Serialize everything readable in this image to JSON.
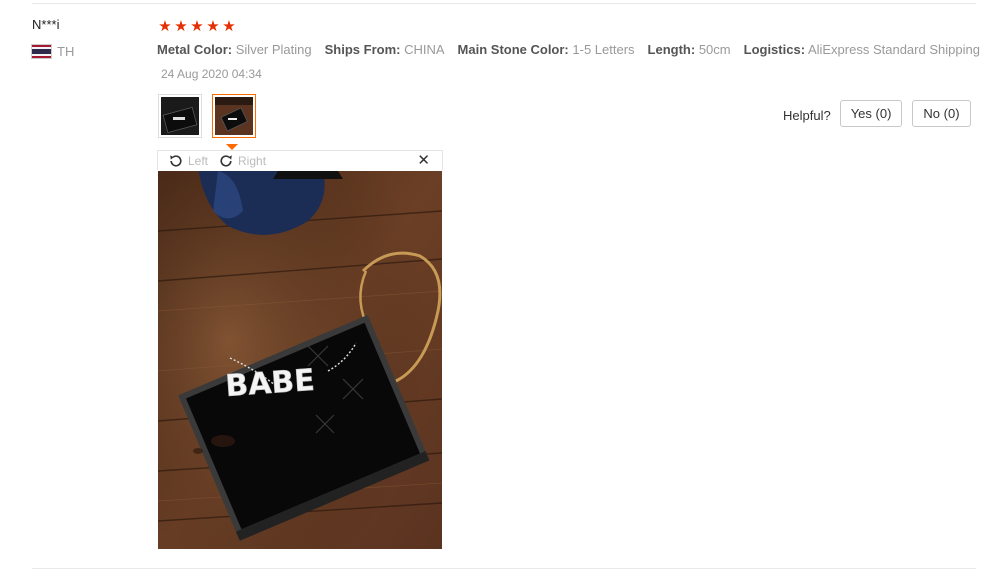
{
  "review": {
    "user_name": "N***i",
    "country_code": "TH",
    "rating": 5,
    "stars": [
      "★",
      "★",
      "★",
      "★",
      "★"
    ],
    "attributes": [
      {
        "key": "Metal Color:",
        "value": "Silver Plating"
      },
      {
        "key": "Ships From:",
        "value": "CHINA"
      },
      {
        "key": "Main Stone Color:",
        "value": "1-5 Letters"
      },
      {
        "key": "Length:",
        "value": "50cm"
      },
      {
        "key": "Logistics:",
        "value": "AliExpress Standard Shipping"
      }
    ],
    "date": "24 Aug 2020 04:34"
  },
  "helpful": {
    "label": "Helpful?",
    "yes_label": "Yes (0)",
    "no_label": "No (0)"
  },
  "viewer": {
    "rotate_left_label": "Left",
    "rotate_right_label": "Right",
    "close_glyph": "✕",
    "photo_text": "BABE"
  },
  "colors": {
    "star": "#e62e04",
    "active_thumb_border": "#ff6a00",
    "muted_text": "#999999"
  }
}
